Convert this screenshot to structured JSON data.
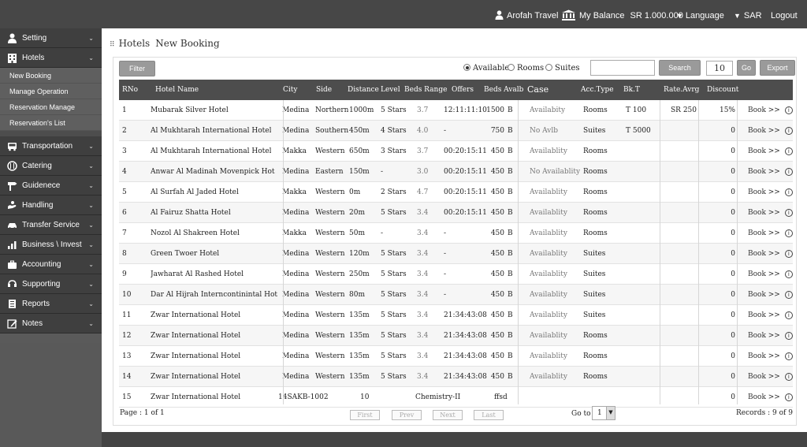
{
  "topbar": {
    "user": "Arofah Travel",
    "balance_label": "My Balance",
    "balance_value": "SR 1.000.000",
    "language": "Language",
    "currency": "SAR",
    "logout": "Logout"
  },
  "sidebar": {
    "items": [
      {
        "label": "Setting",
        "icon": "person-icon"
      },
      {
        "label": "Hotels",
        "icon": "building-icon"
      },
      {
        "label": "Transportation",
        "icon": "bus-icon"
      },
      {
        "label": "Catering",
        "icon": "cutlery-icon"
      },
      {
        "label": "Guidenece",
        "icon": "signpost-icon"
      },
      {
        "label": "Handling",
        "icon": "hand-icon"
      },
      {
        "label": "Transfer Service",
        "icon": "car-icon"
      },
      {
        "label": "Business \\ Invest",
        "icon": "chart-icon"
      },
      {
        "label": "Accounting",
        "icon": "briefcase-icon"
      },
      {
        "label": "Supporting",
        "icon": "support-icon"
      },
      {
        "label": "Reports",
        "icon": "report-icon"
      },
      {
        "label": "Notes",
        "icon": "edit-icon"
      }
    ],
    "hotels_sub": [
      "New Booking",
      "Manage Operation",
      "Reservation Manage",
      "Reservation's List"
    ]
  },
  "breadcrumb": {
    "section": "Hotels",
    "page": "New Booking"
  },
  "toolbar": {
    "filter": "Filter",
    "radios": [
      "Available",
      "Rooms",
      "Suites"
    ],
    "search_value": "",
    "search_button": "Search",
    "page_size": "10",
    "go": "Go",
    "export": "Export"
  },
  "table": {
    "headers": [
      "RNo",
      "Hotel Name",
      "City",
      "Side",
      "Distance",
      "Level",
      "Beds Range",
      "Offers",
      "Beds Avalb",
      "Case",
      "Acc.Type",
      "Bk.T",
      "Rate.Avrg",
      "Discount"
    ],
    "rows": [
      {
        "rno": "1",
        "name": "Mubarak Silver Hotel",
        "city": "Medina",
        "side": "Northern",
        "distance": "1000m",
        "level": "5 Stars",
        "beds": "3.7",
        "offers": "12:11:11:10",
        "avalb": "1500",
        "b": "B",
        "case": "Availabity",
        "acc": "Rooms",
        "bkt": "T 100",
        "rate": "SR 250",
        "discount": "15%",
        "book": "Book >>"
      },
      {
        "rno": "2",
        "name": "Al Mukhtarah International Hotel",
        "city": "Medina",
        "side": "Southern",
        "distance": "450m",
        "level": "4 Stars",
        "beds": "4.0",
        "offers": "-",
        "avalb": "750",
        "b": "B",
        "case": "No Avlb",
        "acc": "Suites",
        "bkt": "T 5000",
        "rate": "",
        "discount": "0",
        "book": "Book >>"
      },
      {
        "rno": "3",
        "name": "Al Mukhtarah International Hotel",
        "city": "Makka",
        "side": "Western",
        "distance": "650m",
        "level": "3 Stars",
        "beds": "3.7",
        "offers": "00:20:15:11",
        "avalb": "450",
        "b": "B",
        "case": "Availablity",
        "acc": "Rooms",
        "bkt": "",
        "rate": "",
        "discount": "0",
        "book": "Book >>"
      },
      {
        "rno": "4",
        "name": "Anwar Al Madinah Movenpick Hot",
        "city": "Medina",
        "side": "Eastern",
        "distance": "150m",
        "level": "-",
        "beds": "3.0",
        "offers": "00:20:15:11",
        "avalb": "450",
        "b": "B",
        "case": "No Availablity",
        "acc": "Rooms",
        "bkt": "",
        "rate": "",
        "discount": "0",
        "book": "Book >>"
      },
      {
        "rno": "5",
        "name": "Al Surfah Al Jaded Hotel",
        "city": "Makka",
        "side": "Western",
        "distance": "0m",
        "level": "2 Stars",
        "beds": "4.7",
        "offers": "00:20:15:11",
        "avalb": "450",
        "b": "B",
        "case": "Availablity",
        "acc": "Rooms",
        "bkt": "",
        "rate": "",
        "discount": "0",
        "book": "Book >>"
      },
      {
        "rno": "6",
        "name": "Al Fairuz Shatta Hotel",
        "city": "Medina",
        "side": "Western",
        "distance": "20m",
        "level": "5 Stars",
        "beds": "3.4",
        "offers": "00:20:15:11",
        "avalb": "450",
        "b": "B",
        "case": "Availablity",
        "acc": "Rooms",
        "bkt": "",
        "rate": "",
        "discount": "0",
        "book": "Book >>"
      },
      {
        "rno": "7",
        "name": "Nozol Al Shakreen Hotel",
        "city": "Makka",
        "side": "Western",
        "distance": "50m",
        "level": "-",
        "beds": "3.4",
        "offers": "-",
        "avalb": "450",
        "b": "B",
        "case": "Availablity",
        "acc": "Rooms",
        "bkt": "",
        "rate": "",
        "discount": "0",
        "book": "Book >>"
      },
      {
        "rno": "8",
        "name": "Green Twoer Hotel",
        "city": "Medina",
        "side": "Western",
        "distance": "120m",
        "level": "5 Stars",
        "beds": "3.4",
        "offers": "-",
        "avalb": "450",
        "b": "B",
        "case": "Availablity",
        "acc": "Suites",
        "bkt": "",
        "rate": "",
        "discount": "0",
        "book": "Book >>"
      },
      {
        "rno": "9",
        "name": "Jawharat Al Rashed Hotel",
        "city": "Medina",
        "side": "Western",
        "distance": "250m",
        "level": "5 Stars",
        "beds": "3.4",
        "offers": "-",
        "avalb": "450",
        "b": "B",
        "case": "Availablity",
        "acc": "Suites",
        "bkt": "",
        "rate": "",
        "discount": "0",
        "book": "Book >>"
      },
      {
        "rno": "10",
        "name": "Dar Al Hijrah Interncontinintal Hot",
        "city": "Medina",
        "side": "Western",
        "distance": "80m",
        "level": "5 Stars",
        "beds": "3.4",
        "offers": "-",
        "avalb": "450",
        "b": "B",
        "case": "Availablity",
        "acc": "Suites",
        "bkt": "",
        "rate": "",
        "discount": "0",
        "book": "Book >>"
      },
      {
        "rno": "11",
        "name": "Zwar International Hotel",
        "city": "Medina",
        "side": "Western",
        "distance": "135m",
        "level": "5 Stars",
        "beds": "3.4",
        "offers": "21:34:43:08",
        "avalb": "450",
        "b": "B",
        "case": "Availablity",
        "acc": "Suites",
        "bkt": "",
        "rate": "",
        "discount": "0",
        "book": "Book >>"
      },
      {
        "rno": "12",
        "name": "Zwar International Hotel",
        "city": "Medina",
        "side": "Western",
        "distance": "135m",
        "level": "5 Stars",
        "beds": "3.4",
        "offers": "21:34:43:08",
        "avalb": "450",
        "b": "B",
        "case": "Availablity",
        "acc": "Rooms",
        "bkt": "",
        "rate": "",
        "discount": "0",
        "book": "Book >>"
      },
      {
        "rno": "13",
        "name": "Zwar International Hotel",
        "city": "Medina",
        "side": "Western",
        "distance": "135m",
        "level": "5 Stars",
        "beds": "3.4",
        "offers": "21:34:43:08",
        "avalb": "450",
        "b": "B",
        "case": "Availablity",
        "acc": "Rooms",
        "bkt": "",
        "rate": "",
        "discount": "0",
        "book": "Book >>"
      },
      {
        "rno": "14",
        "name": "Zwar International Hotel",
        "city": "Medina",
        "side": "Western",
        "distance": "135m",
        "level": "5 Stars",
        "beds": "3.4",
        "offers": "21:34:43:08",
        "avalb": "450",
        "b": "B",
        "case": "Availablity",
        "acc": "Rooms",
        "bkt": "",
        "rate": "",
        "discount": "0",
        "book": "Book >>"
      }
    ],
    "row15": {
      "rno": "15",
      "name": "Zwar International Hotel",
      "code": "14SAKB-1002",
      "num": "10",
      "subject": "Chemistry-II",
      "extra": "ffsd",
      "discount": "0",
      "book": "Book >>"
    }
  },
  "footer": {
    "page_info": "Page : 1 of 1",
    "first": "First",
    "prev": "Prev",
    "next": "Next",
    "last": "Last",
    "goto_label": "Go to",
    "goto_value": "1",
    "records": "Records : 9 of 9"
  }
}
